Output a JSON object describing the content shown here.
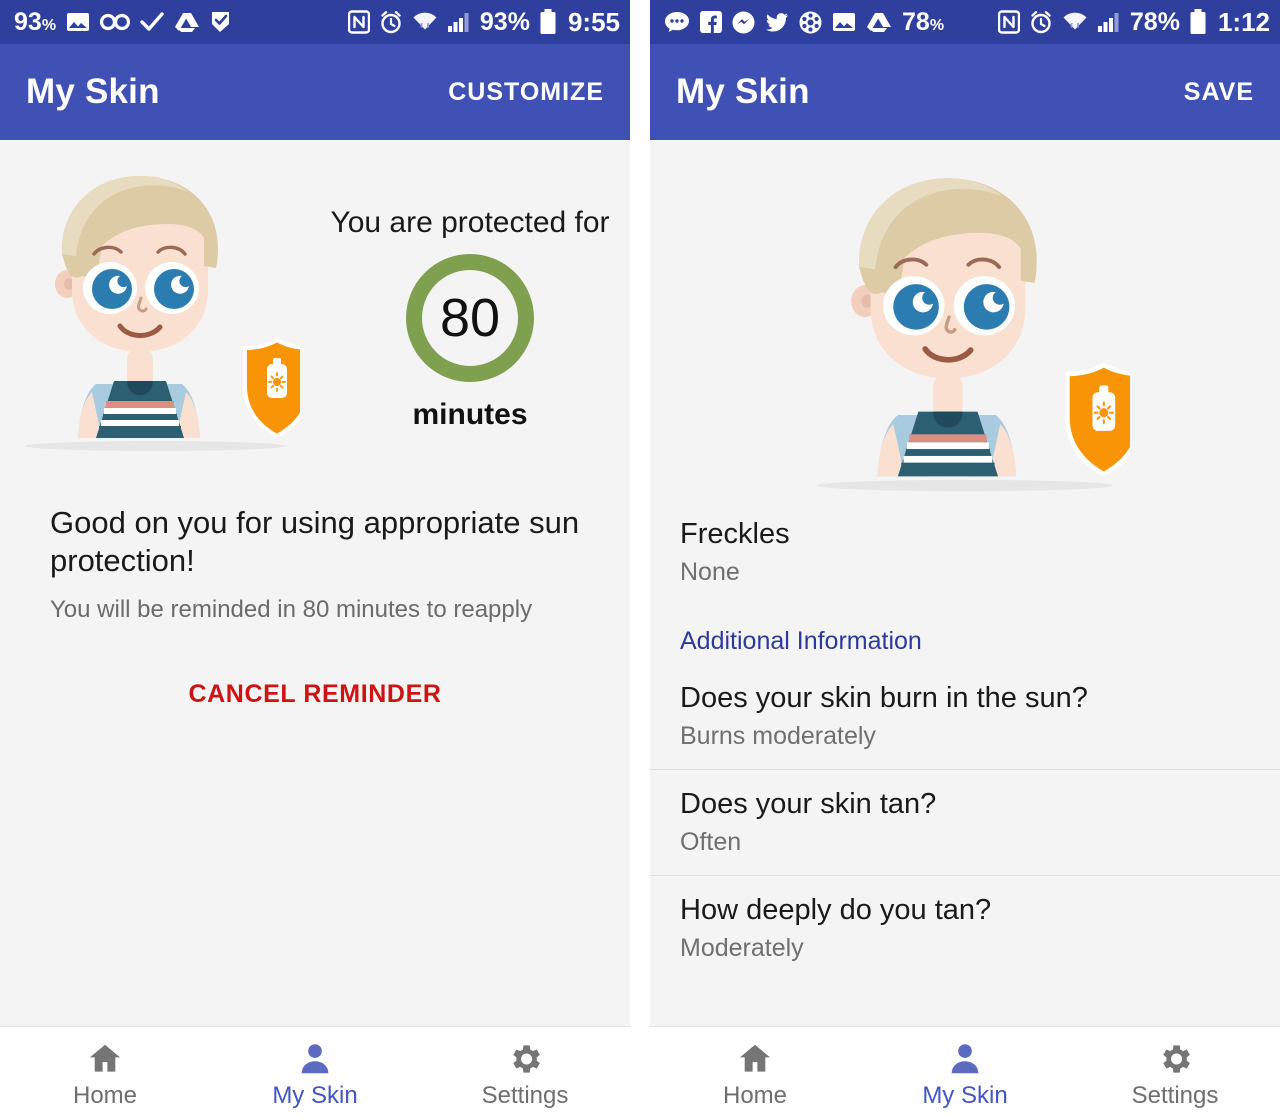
{
  "left_phone": {
    "status_bar": {
      "battery_percent_left": "93",
      "percent_suffix": "%",
      "icons_left": [
        "photo-icon",
        "voicemail-icon",
        "check-icon",
        "google-drive-icon",
        "tick-tick-icon"
      ],
      "icons_right": [
        "nfc-icon",
        "alarm-icon",
        "wifi-icon",
        "cell-signal-icon"
      ],
      "battery_percent_right": "93%",
      "clock": "9:55"
    },
    "app_bar": {
      "title": "My Skin",
      "action_label": "CUSTOMIZE"
    },
    "timer": {
      "caption": "You are protected for",
      "value": "80",
      "unit": "minutes",
      "ring_color": "#7fa04f"
    },
    "message": {
      "title": "Good on you for using appropriate sun protection!",
      "subtitle": "You will be reminded in 80 minutes to reapply",
      "cancel_label": "CANCEL REMINDER",
      "cancel_color": "#cc1414"
    }
  },
  "right_phone": {
    "status_bar": {
      "icons_left": [
        "messages-icon",
        "facebook-icon",
        "messenger-icon",
        "twitter-icon",
        "snowflake-icon",
        "photo-icon",
        "google-drive-icon"
      ],
      "battery_percent_left": "78",
      "percent_suffix": "%",
      "icons_right": [
        "nfc-icon",
        "alarm-icon",
        "wifi-icon",
        "cell-signal-icon"
      ],
      "battery_percent_right": "78%",
      "clock": "1:12"
    },
    "app_bar": {
      "title": "My Skin",
      "action_label": "SAVE"
    },
    "fields": [
      {
        "label": "Freckles",
        "value": "None"
      }
    ],
    "section_title": "Additional Information",
    "section_color": "#2b3a9c",
    "questions": [
      {
        "label": "Does your skin burn in the sun?",
        "value": "Burns moderately"
      },
      {
        "label": "Does your skin tan?",
        "value": "Often"
      },
      {
        "label": "How deeply do you tan?",
        "value": "Moderately"
      }
    ]
  },
  "bottom_nav": {
    "items": [
      {
        "label": "Home",
        "icon": "home-icon",
        "active": false
      },
      {
        "label": "My Skin",
        "icon": "person-icon",
        "active": true
      },
      {
        "label": "Settings",
        "icon": "gear-icon",
        "active": false
      }
    ],
    "active_color": "#4355c4",
    "inactive_color": "#6e6e6e"
  },
  "theme": {
    "app_bar_color": "#3f51b5",
    "status_bar_color": "#2f3f9e",
    "background": "#f4f4f4",
    "shield_color": "#f89406",
    "skin_color": "#fae0d0",
    "hair_color": "#ddcba5",
    "eye_color": "#2b7cb0",
    "shirt_color": "#2d5f73",
    "sleeve_color": "#a8cbe0"
  }
}
